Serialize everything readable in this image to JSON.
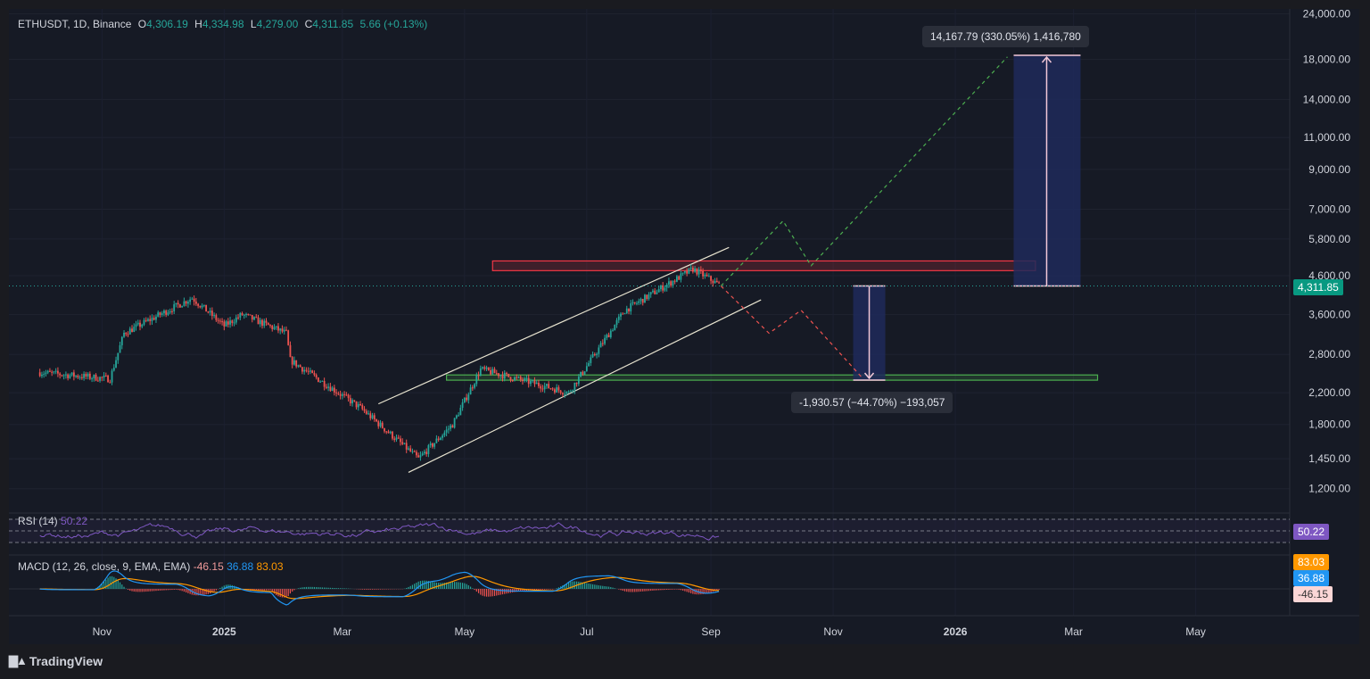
{
  "header": {
    "symbol": "ETHUSDT, 1D, Binance",
    "o_label": "O",
    "o_value": "4,306.19",
    "h_label": "H",
    "h_value": "4,334.98",
    "l_label": "L",
    "l_value": "4,279.00",
    "c_label": "C",
    "c_value": "4,311.85",
    "change": "5.66 (+0.13%)"
  },
  "price_axis": {
    "ticks": [
      "24,000.00",
      "18,000.00",
      "14,000.00",
      "11,000.00",
      "9,000.00",
      "7,000.00",
      "5,800.00",
      "4,600.00",
      "3,600.00",
      "2,800.00",
      "2,200.00",
      "1,800.00",
      "1,450.00",
      "1,200.00"
    ],
    "last_price": "4,311.85"
  },
  "time_axis": [
    "Nov",
    "2025",
    "Mar",
    "May",
    "Jul",
    "Sep",
    "Nov",
    "2026",
    "Mar",
    "May"
  ],
  "measure_up": "14,167.79 (330.05%) 1,416,780",
  "measure_down": "-1,930.57 (−44.70%) −193,057",
  "rsi": {
    "label": "RSI (14)",
    "value": "50.22"
  },
  "macd": {
    "label": "MACD (12, 26, close, 9, EMA, EMA)",
    "hist": "-46.15",
    "macd": "36.88",
    "signal": "83.03"
  },
  "brand": "TradingView",
  "colors": {
    "up": "#26a69a",
    "down": "#ef5350",
    "rsi": "#7e57c2",
    "macd": "#2196f3",
    "signal": "#ff9800",
    "resistance": "#f23645",
    "support": "#4caf50",
    "measure_fill": "#1e2a5a"
  },
  "chart_data": {
    "type": "candlestick",
    "title": "ETHUSDT, 1D, Binance",
    "y_scale": "log",
    "ylim": [
      1100,
      24000
    ],
    "x_ticks": [
      "Nov",
      "2025",
      "Mar",
      "May",
      "Jul",
      "Sep",
      "Nov",
      "2026",
      "Mar",
      "May"
    ],
    "price_path": [
      {
        "t": "2024-10-01",
        "price": 2500
      },
      {
        "t": "2024-11-05",
        "price": 2400
      },
      {
        "t": "2024-11-12",
        "price": 3200
      },
      {
        "t": "2024-12-16",
        "price": 4000
      },
      {
        "t": "2025-01-01",
        "price": 3350
      },
      {
        "t": "2025-01-10",
        "price": 3600
      },
      {
        "t": "2025-02-01",
        "price": 3200
      },
      {
        "t": "2025-02-03",
        "price": 2700
      },
      {
        "t": "2025-03-10",
        "price": 2000
      },
      {
        "t": "2025-04-08",
        "price": 1450
      },
      {
        "t": "2025-04-25",
        "price": 1800
      },
      {
        "t": "2025-05-09",
        "price": 2550
      },
      {
        "t": "2025-06-22",
        "price": 2200
      },
      {
        "t": "2025-07-20",
        "price": 3700
      },
      {
        "t": "2025-08-23",
        "price": 4800
      },
      {
        "t": "2025-09-06",
        "price": 4311.85
      }
    ],
    "resistance_zone": [
      4750,
      5050
    ],
    "support_zone": [
      2380,
      2460
    ],
    "bull_projection": [
      {
        "t": "2025-09-06",
        "price": 4311.85
      },
      {
        "t": "2025-10-07",
        "price": 6500
      },
      {
        "t": "2025-10-21",
        "price": 4900
      },
      {
        "t": "2026-01-27",
        "price": 18300
      }
    ],
    "bear_projection": [
      {
        "t": "2025-09-06",
        "price": 4311.85
      },
      {
        "t": "2025-09-30",
        "price": 3200
      },
      {
        "t": "2025-10-16",
        "price": 3700
      },
      {
        "t": "2025-11-16",
        "price": 2400
      }
    ],
    "measures": [
      {
        "from": 4311.85,
        "to": 18479.64,
        "change": 14167.79,
        "pct": 330.05
      },
      {
        "from": 4311.85,
        "to": 2381.28,
        "change": -1930.57,
        "pct": -44.7
      }
    ],
    "rsi_value": 50.22,
    "macd_values": {
      "macd": 36.88,
      "signal": 83.03,
      "histogram": -46.15
    }
  }
}
